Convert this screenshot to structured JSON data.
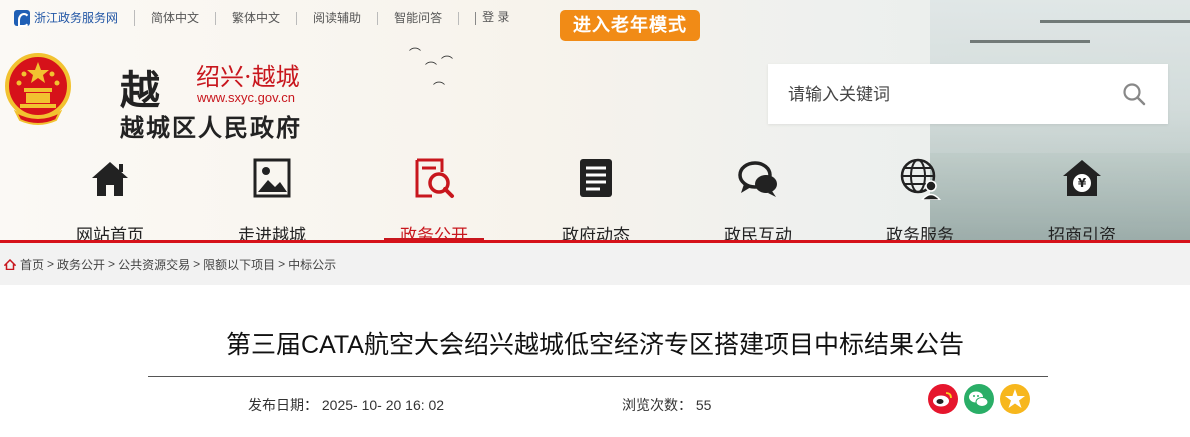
{
  "topbar": {
    "zj_link": "浙江政务服务网",
    "simplified": "简体中文",
    "traditional": "繁体中文",
    "reading_aid": "阅读辅助",
    "smart_qa": "智能问答",
    "login": "登 录",
    "elder_mode": "进入老年模式"
  },
  "logo": {
    "glyph": "越",
    "title": "绍兴·越城",
    "url": "www.sxyc.gov.cn",
    "gov_name": "越城区人民政府"
  },
  "search": {
    "placeholder": "请输入关键词"
  },
  "nav": {
    "items": [
      {
        "label": "网站首页",
        "icon": "home-icon"
      },
      {
        "label": "走进越城",
        "icon": "picture-icon"
      },
      {
        "label": "政务公开",
        "icon": "document-search-icon"
      },
      {
        "label": "政府动态",
        "icon": "news-icon"
      },
      {
        "label": "政民互动",
        "icon": "chat-icon"
      },
      {
        "label": "政务服务",
        "icon": "globe-user-icon"
      },
      {
        "label": "招商引资",
        "icon": "yen-house-icon"
      }
    ],
    "active": "政务公开"
  },
  "breadcrumb": [
    "首页",
    "政务公开",
    "公共资源交易",
    "限额以下项目",
    "中标公示"
  ],
  "article": {
    "title": "第三届CATA航空大会绍兴越城低空经济专区搭建项目中标结果公告",
    "date_label": "发布日期：",
    "date_value": "2025- 10- 20 16: 02",
    "views_label": "浏览次数：",
    "views_value": "55"
  },
  "share": [
    "weibo-icon",
    "wechat-icon",
    "qzone-icon"
  ],
  "colors": {
    "accent_red": "#c8161d",
    "elder_orange": "#f18b16",
    "zj_blue": "#1f5fb5"
  }
}
